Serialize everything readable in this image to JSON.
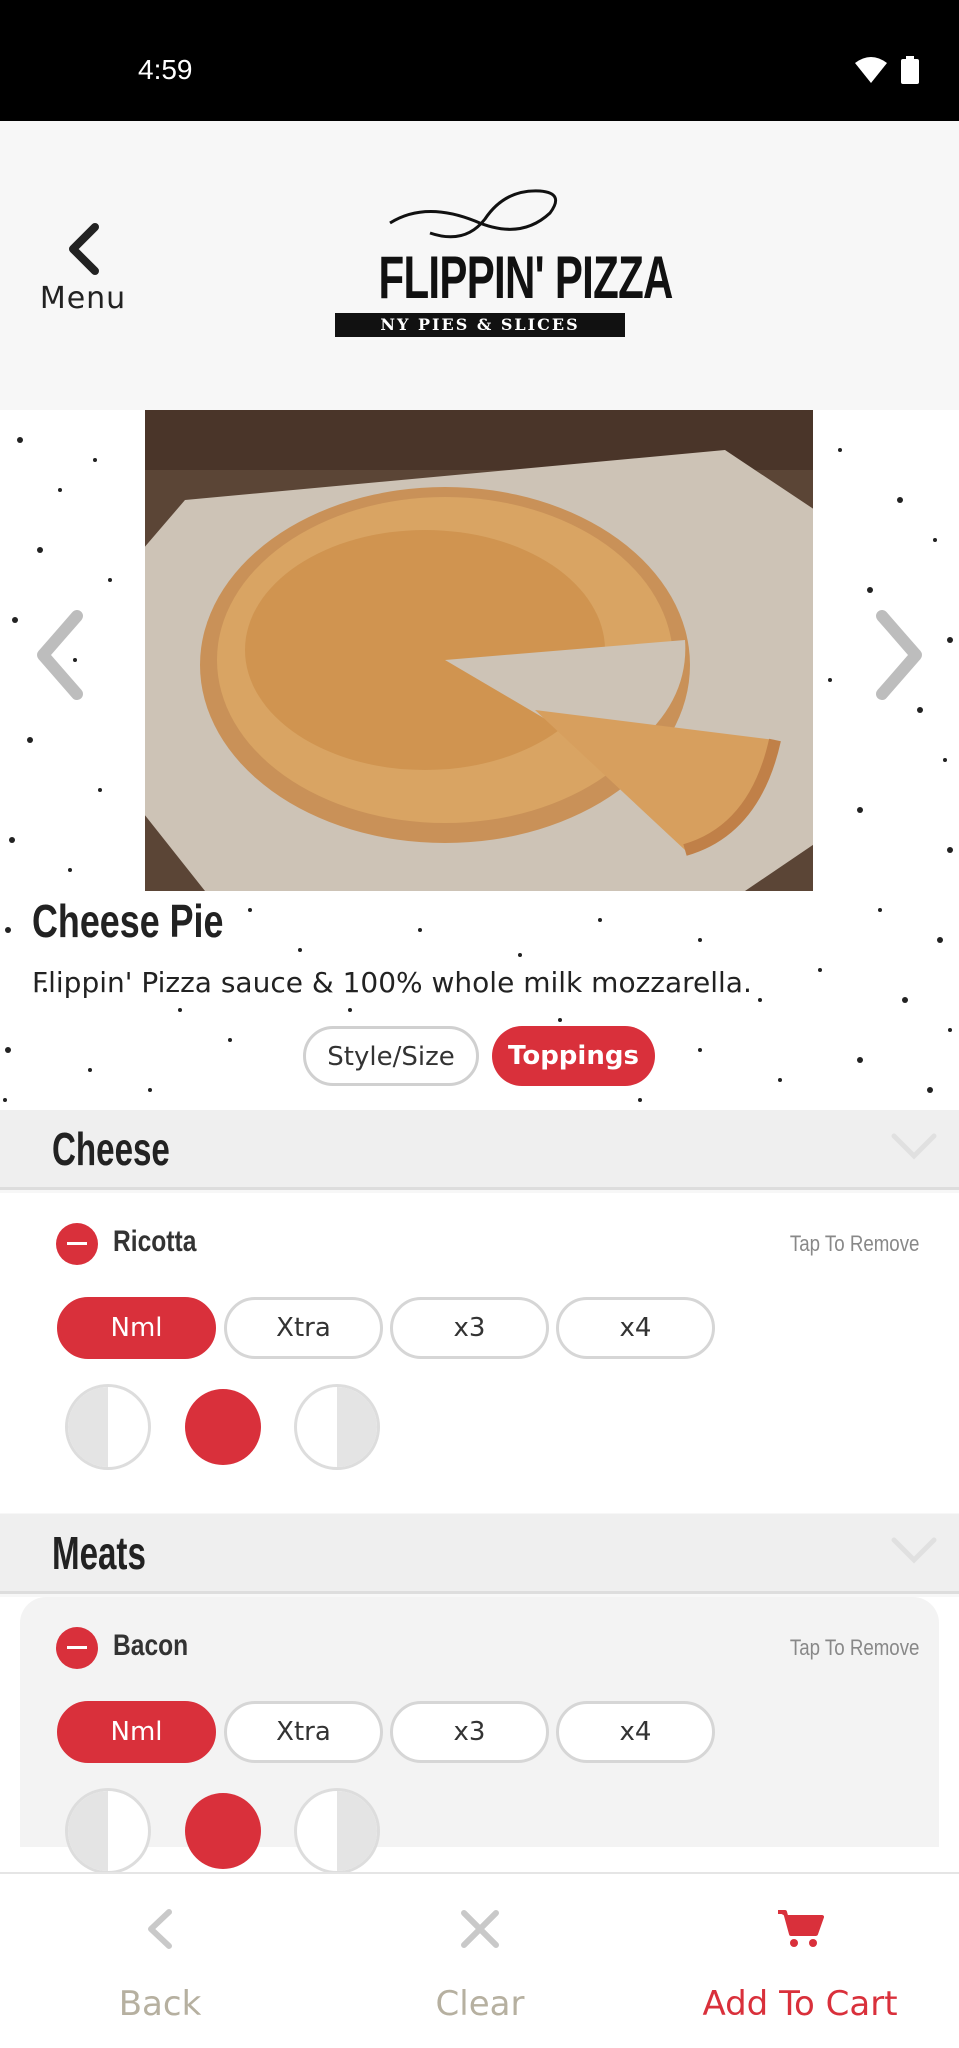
{
  "status_bar": {
    "time": "4:59",
    "icons": [
      "wifi-icon",
      "battery-icon"
    ]
  },
  "header": {
    "back_label": "Menu",
    "logo": {
      "name": "FLIPPIN' PIZZA",
      "tagline": "NY PIES & SLICES"
    }
  },
  "product": {
    "title": "Cheese Pie",
    "description": "Flippin' Pizza sauce & 100% whole milk mozzarella.",
    "tabs": [
      {
        "label": "Style/Size",
        "active": false
      },
      {
        "label": "Toppings",
        "active": true
      }
    ]
  },
  "sections": [
    {
      "title": "Cheese",
      "toppings": [
        {
          "name": "Ricotta",
          "remove_label": "Tap To Remove",
          "amounts": [
            "Nml",
            "Xtra",
            "x3",
            "x4"
          ],
          "selected_amount": "Nml",
          "placement": [
            "left-half",
            "whole",
            "right-half"
          ],
          "selected_placement": "whole"
        }
      ]
    },
    {
      "title": "Meats",
      "toppings": [
        {
          "name": "Bacon",
          "remove_label": "Tap To Remove",
          "amounts": [
            "Nml",
            "Xtra",
            "x3",
            "x4"
          ],
          "selected_amount": "Nml",
          "placement": [
            "left-half",
            "whole",
            "right-half"
          ],
          "selected_placement": "whole"
        }
      ]
    }
  ],
  "bottom_bar": {
    "back_label": "Back",
    "clear_label": "Clear",
    "cart_label": "Add To Cart"
  },
  "colors": {
    "accent": "#d9303b",
    "muted": "#b6b0a0",
    "section_bg": "#efefef"
  }
}
